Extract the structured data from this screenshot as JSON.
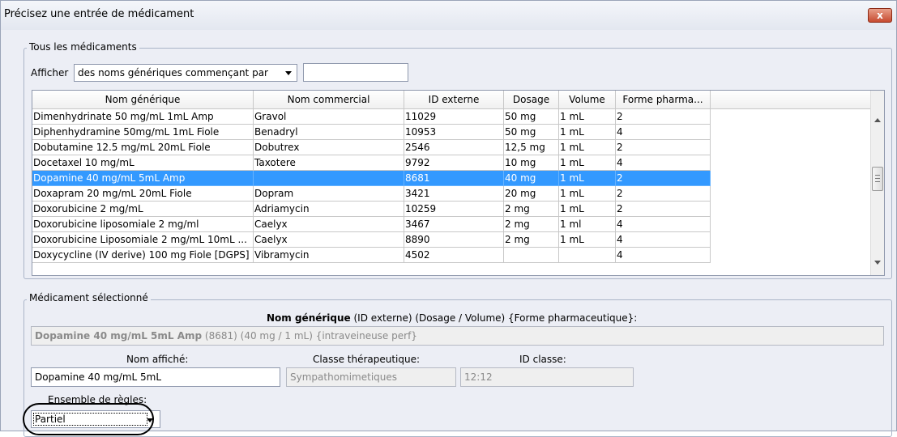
{
  "window": {
    "title": "Précisez une entrée de médicament",
    "close_label": "x"
  },
  "all_meds": {
    "legend": "Tous les médicaments",
    "show_label": "Afficher",
    "filter_selected": "des noms génériques commençant par",
    "filter_value": ""
  },
  "table": {
    "columns": [
      "Nom générique",
      "Nom commercial",
      "ID externe",
      "Dosage",
      "Volume",
      "Forme pharma..."
    ],
    "rows": [
      [
        "Dimenhydrinate  50 mg/mL  1mL Amp",
        "Gravol",
        "11029",
        "50 mg",
        "1 mL",
        "2"
      ],
      [
        "Diphenhydramine 50mg/mL 1mL Fiole",
        "Benadryl",
        "10953",
        "50 mg",
        "1 mL",
        "4"
      ],
      [
        "Dobutamine 12.5 mg/mL  20mL Fiole",
        "Dobutrex",
        "2546",
        "12,5 mg",
        "1 mL",
        "2"
      ],
      [
        "Docetaxel 10 mg/mL",
        "Taxotere",
        "9792",
        "10 mg",
        "1 mL",
        "4"
      ],
      [
        "Dopamine 40 mg/mL  5mL Amp",
        "",
        "8681",
        "40 mg",
        "1 mL",
        "2"
      ],
      [
        "Doxapram 20 mg/mL  20mL Fiole",
        "Dopram",
        "3421",
        "20 mg",
        "1 mL",
        "2"
      ],
      [
        "Doxorubicine 2 mg/mL",
        "Adriamycin",
        "10259",
        "2 mg",
        "1 mL",
        "2"
      ],
      [
        "Doxorubicine liposomiale 2 mg/ml",
        "Caelyx",
        "3467",
        "2 mg",
        "1 ml",
        "4"
      ],
      [
        "Doxorubicine Liposomiale 2 mg/mL  10mL ...",
        "Caelyx",
        "8890",
        "2 mg",
        "1 mL",
        "4"
      ],
      [
        "Doxycycline (IV derive) 100 mg Fiole [DGPS]",
        "Vibramycin",
        "4502",
        "",
        "",
        "4"
      ]
    ],
    "selected_row": 4
  },
  "selected": {
    "legend": "Médicament sélectionné",
    "heading_bold": "Nom générique",
    "heading_rest": " (ID externe) (Dosage / Volume) {Forme pharmaceutique}:",
    "summary_bold": "Dopamine 40 mg/mL 5mL Amp",
    "summary_rest": " (8681) (40 mg / 1 mL) {intraveineuse perf}",
    "display_name_label": "Nom affiché:",
    "display_name_value": "Dopamine 40 mg/mL  5mL",
    "class_label": "Classe thérapeutique:",
    "class_value": "Sympathomimetiques",
    "class_id_label": "ID classe:",
    "class_id_value": "12:12",
    "rules_label": "Ensemble de règles:",
    "rules_value": "Partiel"
  }
}
